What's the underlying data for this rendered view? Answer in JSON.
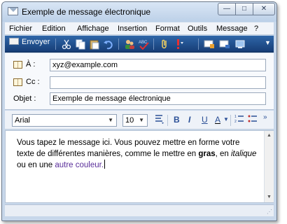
{
  "window": {
    "title": "Exemple de message électronique",
    "controls": {
      "minimize": "—",
      "maximize": "□",
      "close": "✕"
    }
  },
  "menu": {
    "items": [
      "Fichier",
      "Edition",
      "Affichage",
      "Insertion",
      "Format",
      "Outils",
      "Message",
      "?"
    ]
  },
  "toolbar": {
    "send_label": "Envoyer",
    "icons": [
      "cut-icon",
      "copy-icon",
      "paste-icon",
      "undo-icon",
      "contacts-icon",
      "spellcheck-icon",
      "attach-icon",
      "priority-icon",
      "sign-icon",
      "encrypt-icon",
      "offline-icon"
    ],
    "colors": {
      "bar_top": "#2f66a8",
      "bar_bottom": "#163d76"
    }
  },
  "fields": {
    "to": {
      "label": "À :",
      "value": "xyz@example.com"
    },
    "cc": {
      "label": "Cc :",
      "value": ""
    },
    "subject": {
      "label": "Objet :",
      "value": "Exemple de message électronique"
    }
  },
  "format_bar": {
    "font": "Arial",
    "size": "10",
    "bold": "B",
    "italic": "I",
    "underline": "U",
    "font_color": "A",
    "more": "»"
  },
  "editor": {
    "part1": "Vous tapez le message ici. Vous pouvez mettre en forme votre texte de différentes manières, comme le mettre en ",
    "bold_word": "gras",
    "part2": ", en ",
    "italic_word": "italique",
    "part3": " ou en une ",
    "colored_words": "autre couleur",
    "end": ".",
    "accent_color": "#5a2e9a"
  }
}
